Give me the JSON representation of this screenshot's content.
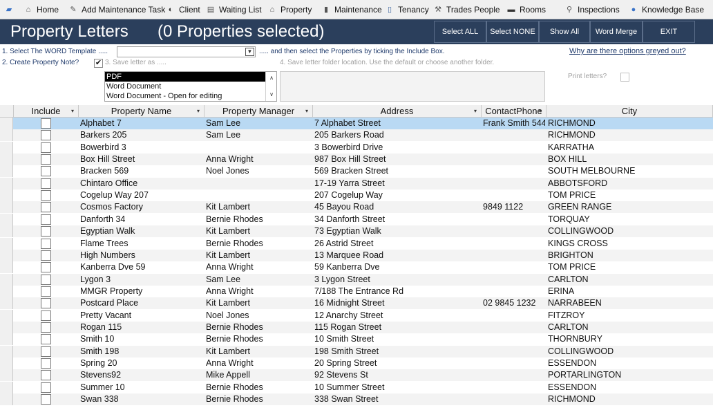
{
  "nav": {
    "items": [
      {
        "label": "Home",
        "icon": "home-icon",
        "glyph": "⌂",
        "color": "#555555"
      },
      {
        "label": "Add Maintenance Task",
        "icon": "wrench-icon",
        "glyph": "✎",
        "color": "#555555"
      },
      {
        "label": "Client",
        "icon": "client-icon",
        "glyph": "◐",
        "color": "#333333"
      },
      {
        "label": "Waiting List",
        "icon": "list-icon",
        "glyph": "▤",
        "color": "#555555"
      },
      {
        "label": "Property",
        "icon": "building-icon",
        "glyph": "⌂",
        "color": "#555555"
      },
      {
        "label": "Maintenance",
        "icon": "bin-icon",
        "glyph": "▮",
        "color": "#555555"
      },
      {
        "label": "Tenancy",
        "icon": "document-icon",
        "glyph": "▯",
        "color": "#4a6fa5"
      },
      {
        "label": "Trades People",
        "icon": "tools-icon",
        "glyph": "⚒",
        "color": "#555555"
      },
      {
        "label": "Rooms",
        "icon": "bed-icon",
        "glyph": "▬",
        "color": "#333333"
      },
      {
        "label": "Inspections",
        "icon": "magnifier-icon",
        "glyph": "⚲",
        "color": "#555555"
      },
      {
        "label": "Knowledge Base",
        "icon": "globe-icon",
        "glyph": "●",
        "color": "#3a73c8"
      }
    ]
  },
  "title": {
    "text": "Property Letters",
    "count": "(0 Properties selected)"
  },
  "toolbar": {
    "select_all": "Select ALL",
    "select_none": "Select NONE",
    "show_all": "Show All",
    "word_merge": "Word Merge",
    "exit": "EXIT"
  },
  "options": {
    "step1": "1. Select The WORD Template .....",
    "step1_after": "..... and then select the Properties by ticking the Include Box.",
    "help_link": "Why are there options greyed out?",
    "step2": "2. Create Property Note?",
    "step2_checked": "✔",
    "step3": "3. Save letter as .....",
    "step4": "4. Save letter folder location. Use the default or choose another folder.",
    "print_label": "Print letters?",
    "save_formats": [
      "PDF",
      "Word Document",
      "Word Document - Open for editing"
    ]
  },
  "table": {
    "columns": [
      {
        "label": "Include",
        "dropdown": "▾"
      },
      {
        "label": "Property Name",
        "dropdown": "▾"
      },
      {
        "label": "Property Manager",
        "dropdown": "▾"
      },
      {
        "label": "Address",
        "dropdown": "▾"
      },
      {
        "label": "ContactPhone",
        "dropdown": "▾"
      },
      {
        "label": "City",
        "dropdown": ""
      }
    ],
    "rows": [
      {
        "name": "Alphabet 7",
        "manager": "Sam Lee",
        "address": "7 Alphabet Street",
        "phone": "Frank Smith 544",
        "city": "RICHMOND"
      },
      {
        "name": "Barkers 205",
        "manager": "Sam Lee",
        "address": "205 Barkers Road",
        "phone": "",
        "city": "RICHMOND"
      },
      {
        "name": "Bowerbird 3",
        "manager": "",
        "address": "3 Bowerbird Drive",
        "phone": "",
        "city": "KARRATHA"
      },
      {
        "name": "Box Hill Street",
        "manager": "Anna Wright",
        "address": "987 Box Hill Street",
        "phone": "",
        "city": "BOX HILL"
      },
      {
        "name": "Bracken 569",
        "manager": "Noel Jones",
        "address": "569 Bracken Street",
        "phone": "",
        "city": "SOUTH MELBOURNE"
      },
      {
        "name": "Chintaro Office",
        "manager": "",
        "address": "17-19 Yarra Street",
        "phone": "",
        "city": "ABBOTSFORD"
      },
      {
        "name": "Cogelup Way 207",
        "manager": "",
        "address": "207 Cogelup Way",
        "phone": "",
        "city": "TOM PRICE"
      },
      {
        "name": "Cosmos Factory",
        "manager": "Kit Lambert",
        "address": "45 Bayou Road",
        "phone": "9849 1122",
        "city": "GREEN RANGE"
      },
      {
        "name": "Danforth 34",
        "manager": "Bernie Rhodes",
        "address": "34 Danforth Street",
        "phone": "",
        "city": "TORQUAY"
      },
      {
        "name": "Egyptian Walk",
        "manager": "Kit Lambert",
        "address": "73 Egyptian Walk",
        "phone": "",
        "city": "COLLINGWOOD"
      },
      {
        "name": "Flame Trees",
        "manager": "Bernie Rhodes",
        "address": "26 Astrid Street",
        "phone": "",
        "city": "KINGS CROSS"
      },
      {
        "name": "High Numbers",
        "manager": "Kit Lambert",
        "address": "13 Marquee Road",
        "phone": "",
        "city": "BRIGHTON"
      },
      {
        "name": "Kanberra Dve 59",
        "manager": "Anna Wright",
        "address": "59 Kanberra Dve",
        "phone": "",
        "city": "TOM PRICE"
      },
      {
        "name": "Lygon 3",
        "manager": "Sam Lee",
        "address": "3 Lygon Street",
        "phone": "",
        "city": "CARLTON"
      },
      {
        "name": "MMGR Property",
        "manager": "Anna Wright",
        "address": "7/188 The Entrance Rd",
        "phone": "",
        "city": "ERINA"
      },
      {
        "name": "Postcard Place",
        "manager": "Kit Lambert",
        "address": "16 Midnight Street",
        "phone": "02 9845 1232",
        "city": "NARRABEEN"
      },
      {
        "name": "Pretty Vacant",
        "manager": "Noel Jones",
        "address": "12 Anarchy Street",
        "phone": "",
        "city": "FITZROY"
      },
      {
        "name": "Rogan 115",
        "manager": "Bernie Rhodes",
        "address": "115 Rogan Street",
        "phone": "",
        "city": "CARLTON"
      },
      {
        "name": "Smith 10",
        "manager": "Bernie Rhodes",
        "address": "10 Smith Street",
        "phone": "",
        "city": "THORNBURY"
      },
      {
        "name": "Smith 198",
        "manager": "Kit Lambert",
        "address": "198 Smith Street",
        "phone": "",
        "city": "COLLINGWOOD"
      },
      {
        "name": "Spring 20",
        "manager": "Anna Wright",
        "address": "20 Spring Street",
        "phone": "",
        "city": "ESSENDON"
      },
      {
        "name": "Stevens92",
        "manager": "Mike Appell",
        "address": "92 Stevens St",
        "phone": "",
        "city": "PORTARLINGTON"
      },
      {
        "name": "Summer 10",
        "manager": "Bernie Rhodes",
        "address": "10 Summer Street",
        "phone": "",
        "city": "ESSENDON"
      },
      {
        "name": "Swan 338",
        "manager": "Bernie Rhodes",
        "address": "338 Swan Street",
        "phone": "",
        "city": "RICHMOND"
      }
    ]
  },
  "colors": {
    "title_bar": "#2b3f5c",
    "selected_row": "#b9d9f3",
    "label_text": "#1f3a6b"
  }
}
